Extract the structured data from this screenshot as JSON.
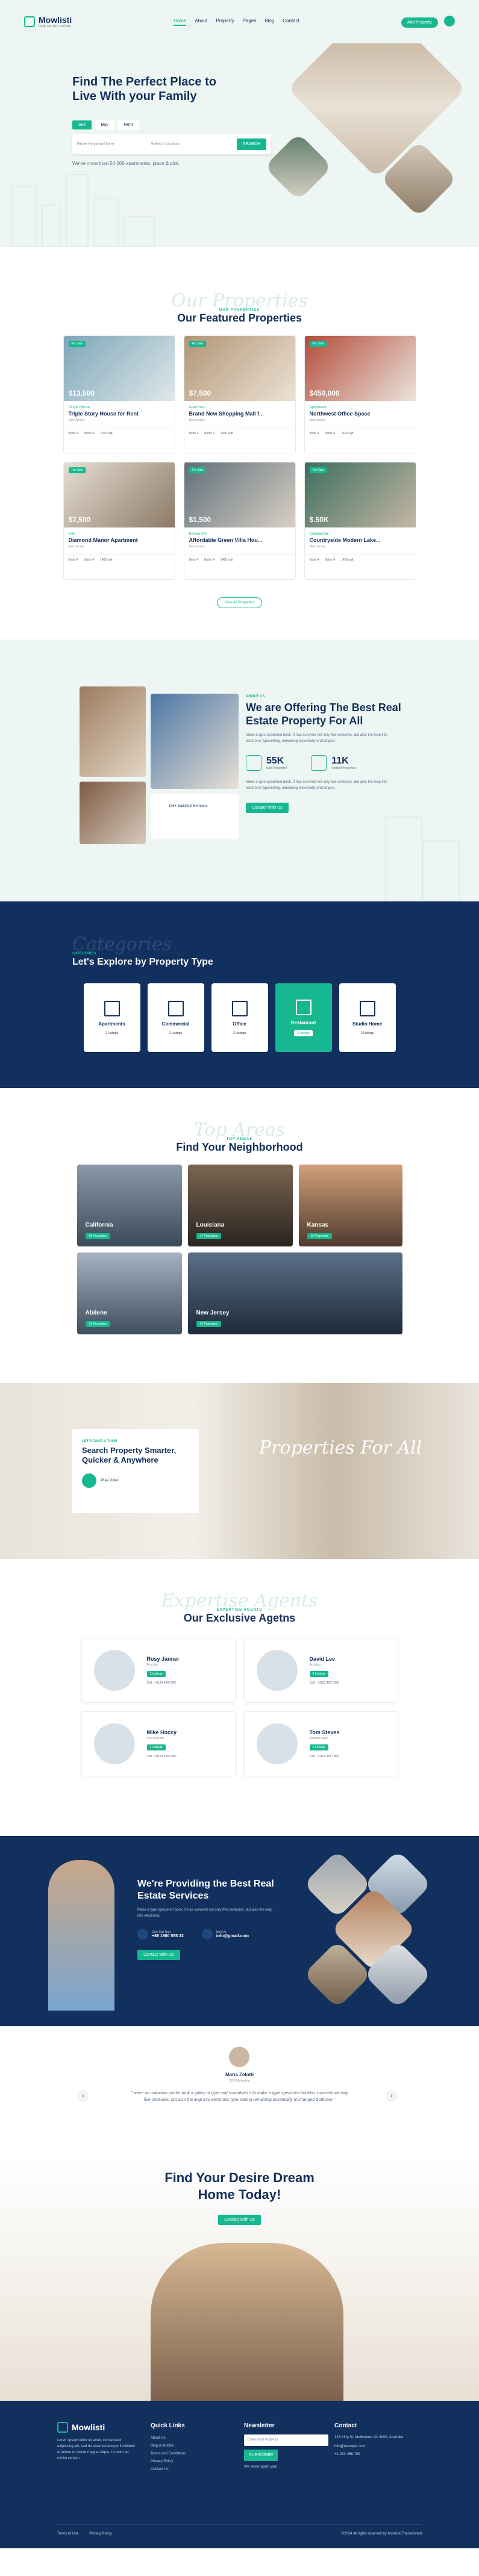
{
  "nav": {
    "logo_name": "Mowlisti",
    "logo_sub": "REAL ESTATE LISTING",
    "menu": [
      "Home",
      "About",
      "Property",
      "Pages",
      "Blog",
      "Contact"
    ],
    "cta": "Add Property"
  },
  "hero": {
    "title": "Find The Perfect Place to Live With your Family",
    "tabs": [
      "Sell",
      "Buy",
      "Rent"
    ],
    "search_placeholder": "Enter Keyword here",
    "location_placeholder": "Select Location",
    "search_button": "SEARCH",
    "subtext": "We've more than 54,000 apartments, place & plot."
  },
  "featured": {
    "script": "Our Properties",
    "kicker": "OUR PROPERTIES",
    "title": "Our Featured Properties",
    "cards": [
      {
        "tag": "For Sale",
        "price": "$13,500",
        "category": "Single House",
        "title": "Triple Story House for Rent",
        "location": "New Jersey",
        "beds": "Beds 4",
        "baths": "Baths 4",
        "area": "1400 sqft"
      },
      {
        "tag": "For Sale",
        "price": "$7,500",
        "category": "Apartment",
        "title": "Brand New Shopping Mall f...",
        "location": "New Jersey",
        "beds": "Beds 4",
        "baths": "Baths 4",
        "area": "1400 sqft"
      },
      {
        "tag": "For Sale",
        "price": "$450,000",
        "category": "Apartment",
        "title": "Northwest Office Space",
        "location": "New Jersey",
        "beds": "Beds 4",
        "baths": "Baths 4",
        "area": "1400 sqft"
      },
      {
        "tag": "For Sale",
        "price": "$7,500",
        "category": "Villa",
        "title": "Diamond Manor Apartment",
        "location": "New Jersey",
        "beds": "Beds 4",
        "baths": "Baths 4",
        "area": "1400 sqft"
      },
      {
        "tag": "For Sale",
        "price": "$1,500",
        "category": "Restaurant",
        "title": "Affordable Green Villa Hou...",
        "location": "New Jersey",
        "beds": "Beds 4",
        "baths": "Baths 4",
        "area": "1400 sqft"
      },
      {
        "tag": "For Sale",
        "price": "$.50K",
        "category": "Commercial",
        "title": "Countryside Modern Lake...",
        "location": "New Jersey",
        "beds": "Beds 4",
        "baths": "Baths 4",
        "area": "1400 sqft"
      }
    ],
    "view_all": "View All Properties"
  },
  "offer": {
    "kicker": "ABOUT US",
    "title": "We are Offering The Best Real Estate Property For All",
    "body": "Make a type specimen book. It has survived not only five centuries, but also the leap into electronic typesetting, remaining essentially unchanged.",
    "stat1_value": "55K",
    "stat1_label": "Sold Properties",
    "stat2_value": "11K",
    "stat2_label": "Verified Properties",
    "body2": "Make a type specimen book. It has survived not only five centuries, but also the leap into electronic typesetting, remaining essentially unchanged.",
    "button": "Contact With Us",
    "customers": "10k+ Satisfied Members"
  },
  "types": {
    "script": "Categories",
    "kicker": "CATEGORIES",
    "title": "Let's Explore by Property Type",
    "items": [
      {
        "name": "Apartments",
        "count": "2 Listings"
      },
      {
        "name": "Commercial",
        "count": "2 Listings"
      },
      {
        "name": "Office",
        "count": "2 Listings"
      },
      {
        "name": "Restaurant",
        "count": "2 Listings"
      },
      {
        "name": "Studio Home",
        "count": "2 Listings"
      }
    ]
  },
  "neighborhood": {
    "script": "Top Areas",
    "kicker": "TOP AREAS",
    "title": "Find Your Neighborhood",
    "items": [
      {
        "name": "California",
        "count": "08 Properties"
      },
      {
        "name": "Louisiana",
        "count": "07 Properties"
      },
      {
        "name": "Kansas",
        "count": "05 Properties"
      },
      {
        "name": "Abilene",
        "count": "02 Properties"
      },
      {
        "name": "New Jersey",
        "count": "04 Properties"
      }
    ]
  },
  "smarter": {
    "kicker": "LET'S TAKE A TOUR",
    "title": "Search Property Smarter, Quicker & Anywhere",
    "play": "Play Video",
    "script": "Properties For All"
  },
  "agents": {
    "script": "Expertise Agents",
    "kicker": "EXPERTISE AGENTS",
    "title": "Our Exclusive Agetns",
    "items": [
      {
        "name": "Rosy Janner",
        "role": "Founder",
        "listings": "2 Listings",
        "phone": "Call : +0123 4567 890"
      },
      {
        "name": "David Lee",
        "role": "Architect",
        "listings": "4 Listings",
        "phone": "Call : +0123 4567 890"
      },
      {
        "name": "Mike Hoccy",
        "role": "Ceo Mowlisti",
        "listings": "3 Listings",
        "phone": "Call : +0123 4567 890"
      },
      {
        "name": "Tom Steves",
        "role": "Market Expert",
        "listings": "2 Listings",
        "phone": "Call : +0123 4567 890"
      }
    ]
  },
  "services": {
    "title": "We're Providing the Best Real Estate Services",
    "body": "Make a type specimen book. It has survived not only five centuries, but also the leap into electronic.",
    "call_label": "Give Call Now",
    "call_value": "+88 1900 555 22",
    "mail_label": "Mail Us",
    "mail_value": "info@gmail.com",
    "button": "Contact With Us"
  },
  "testimonial": {
    "name": "Maria Zelotti",
    "role": "CEO/Marketing",
    "quote": "\" when an unknown printer took a galley of type and scrambled it to make a type specimen booktas survived not only five centuries, but also the leap into electronic type setting remaining essentially unchanged Software \""
  },
  "cta": {
    "title": "Find Your Desire Dream Home Today!",
    "button": "Contact With Us"
  },
  "footer": {
    "about": "Lorem ipsum dolor sit amet, consectetur adipiscing elit, sed do eiusmod tempor incididunt ut labore et dolore magna aliqua. Ut enim ad minim veniam.",
    "quick_title": "Quick Links",
    "links": [
      "About Us",
      "Blog & Articles",
      "Terms and Conditions",
      "Privacy Policy",
      "Contact Us"
    ],
    "news_title": "Newsletter",
    "news_placeholder": "Enter Mail Address",
    "news_button": "SUBSCRIBE",
    "news_note": "We never spam you!",
    "contact_title": "Contact",
    "address": "123 King St, Melbourne Vic 3000, Australia",
    "email": "info@example.com",
    "phone": "+1-234-456-789",
    "bottom_links": [
      "Terms of Use",
      "Privacy Policy"
    ],
    "copyright": "©2024 All rights reserved by Mowlisti Themeforest"
  }
}
